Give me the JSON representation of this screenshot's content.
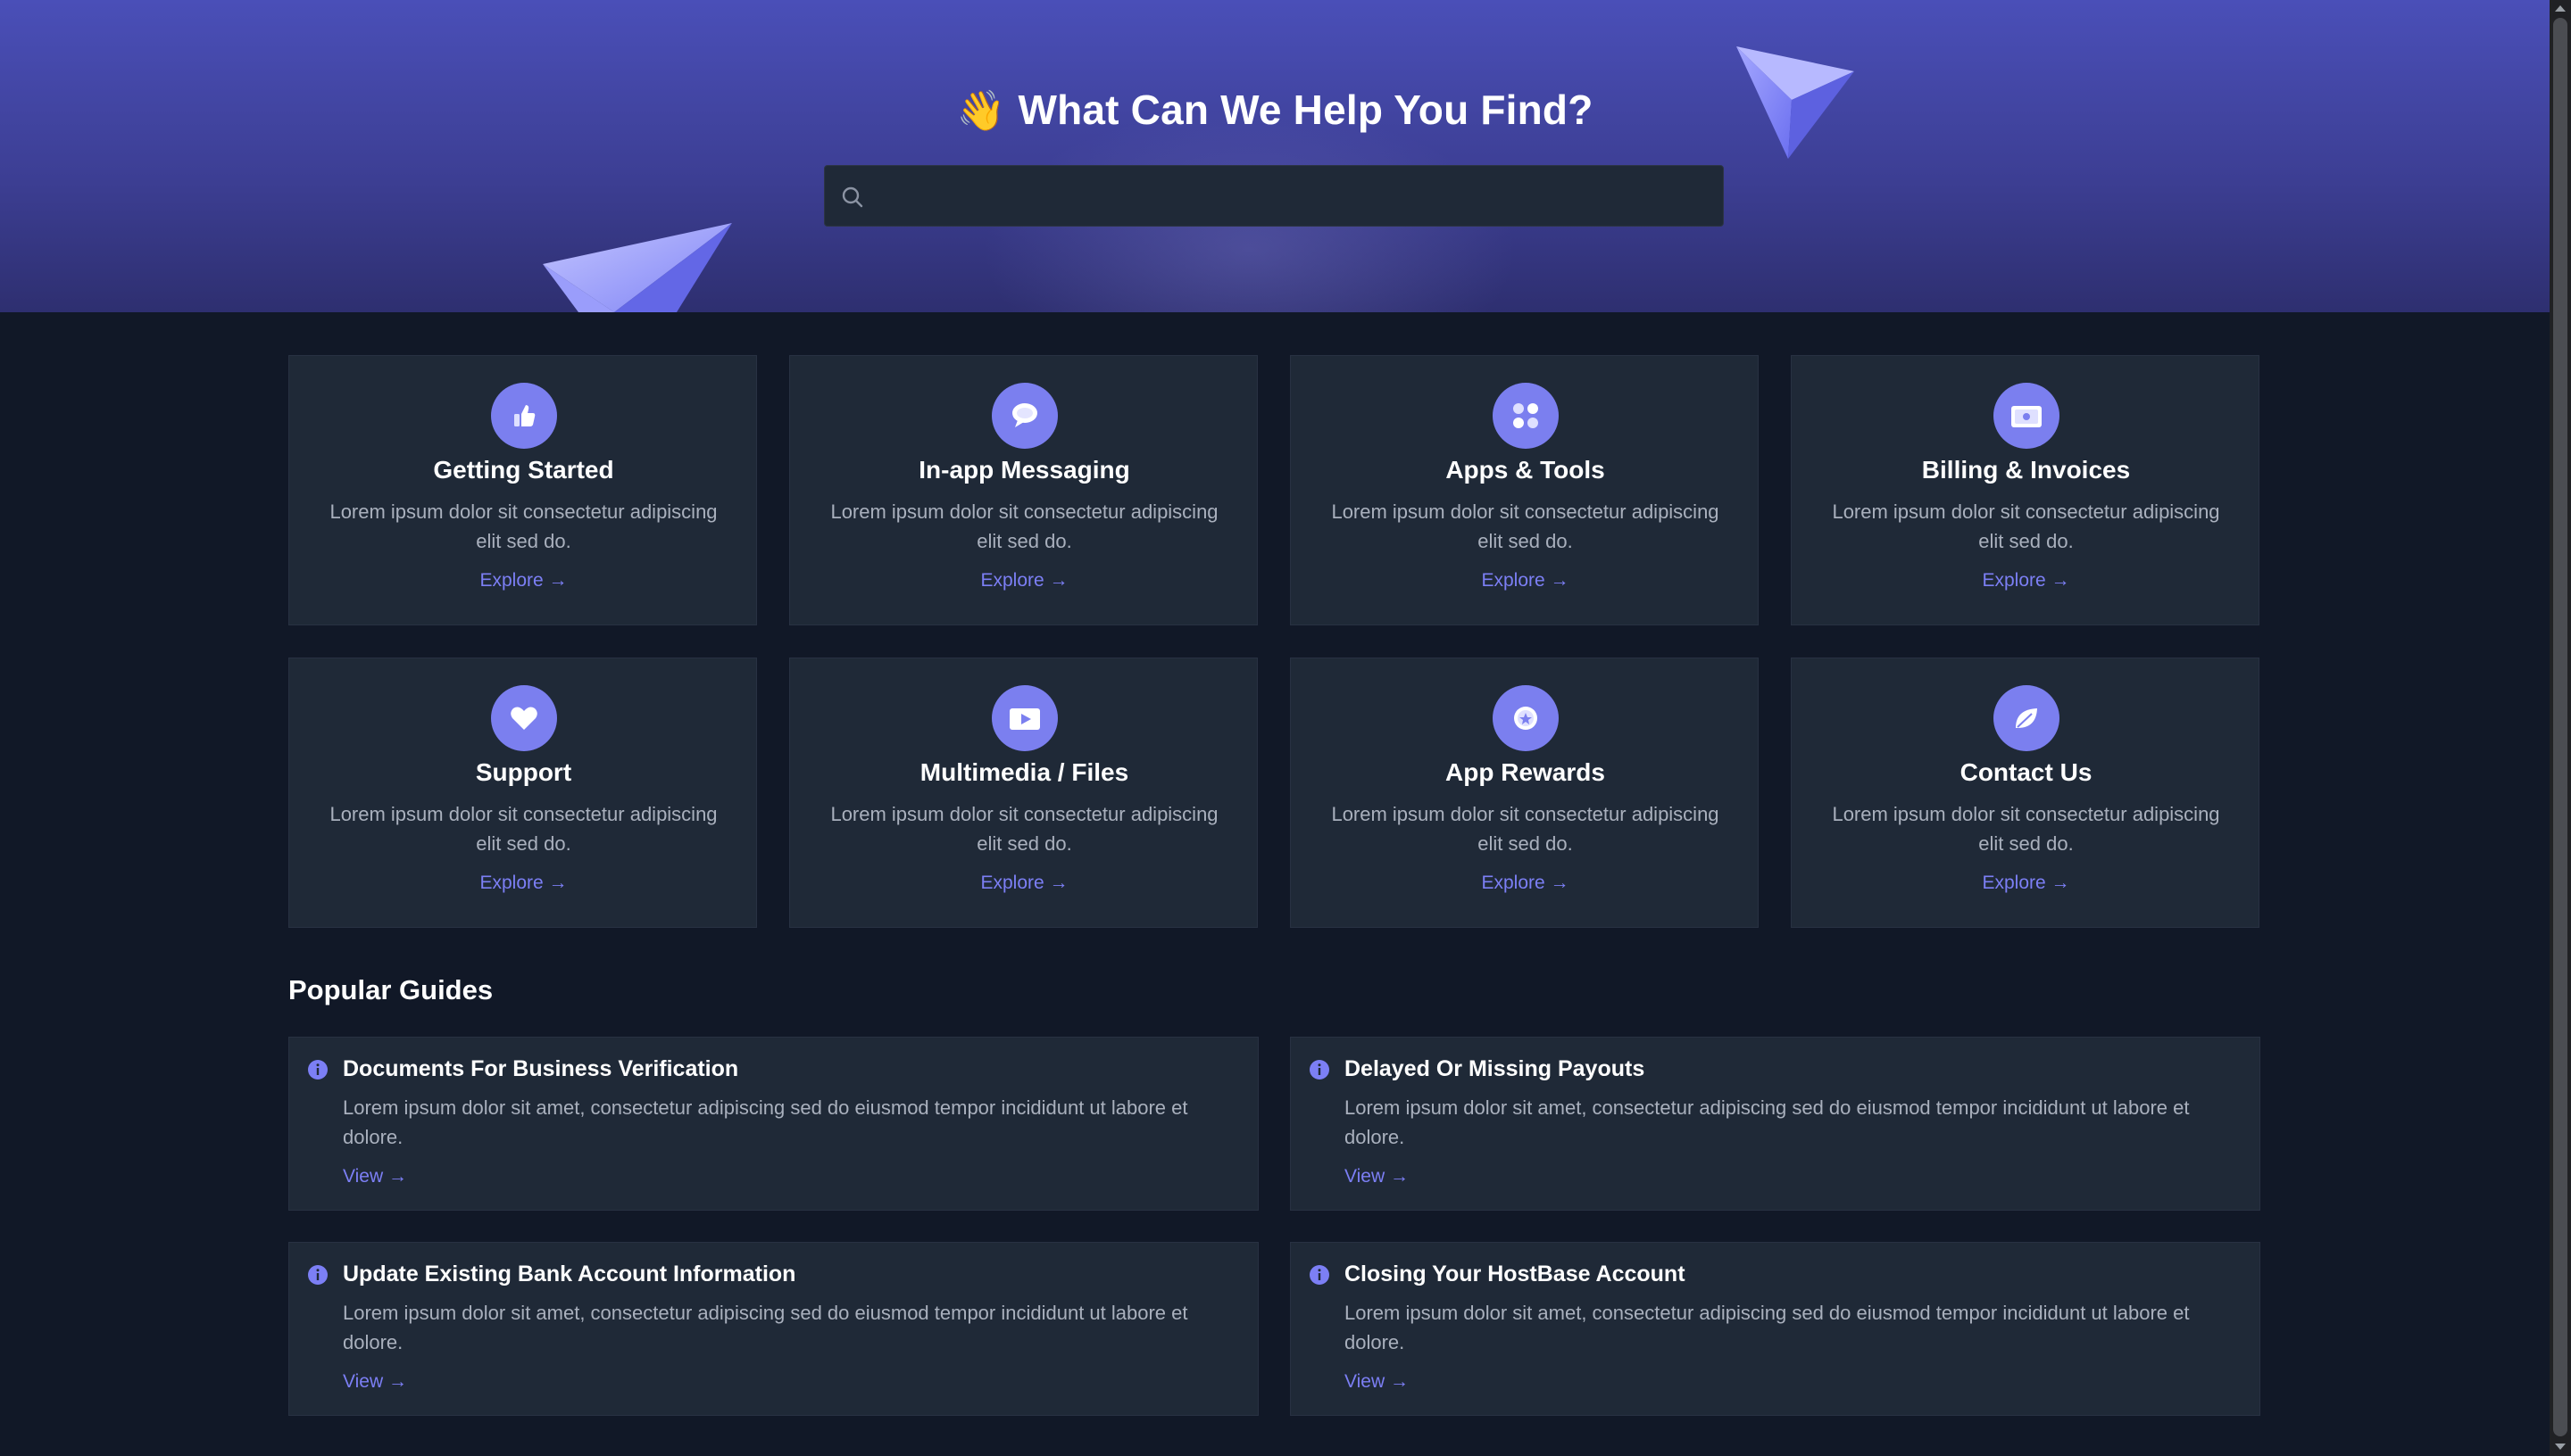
{
  "hero": {
    "emoji": "👋",
    "title": "What Can We Help You Find?",
    "search_value": ""
  },
  "colors": {
    "accent": "#7c7ff5",
    "hero_top": "#4a4fb8",
    "background": "#111827",
    "card": "#1f2937"
  },
  "categories": [
    {
      "title": "Getting Started",
      "desc": "Lorem ipsum dolor sit consectetur adipiscing elit sed do.",
      "link": "Explore →",
      "icon": "thumbs-up-icon"
    },
    {
      "title": "In-app Messaging",
      "desc": "Lorem ipsum dolor sit consectetur adipiscing elit sed do.",
      "link": "Explore →",
      "icon": "chat-bubble-icon"
    },
    {
      "title": "Apps & Tools",
      "desc": "Lorem ipsum dolor sit consectetur adipiscing elit sed do.",
      "link": "Explore →",
      "icon": "apps-grid-icon"
    },
    {
      "title": "Billing & Invoices",
      "desc": "Lorem ipsum dolor sit consectetur adipiscing elit sed do.",
      "link": "Explore →",
      "icon": "wallet-icon"
    },
    {
      "title": "Support",
      "desc": "Lorem ipsum dolor sit consectetur adipiscing elit sed do.",
      "link": "Explore →",
      "icon": "heart-icon"
    },
    {
      "title": "Multimedia / Files",
      "desc": "Lorem ipsum dolor sit consectetur adipiscing elit sed do.",
      "link": "Explore →",
      "icon": "video-icon"
    },
    {
      "title": "App Rewards",
      "desc": "Lorem ipsum dolor sit consectetur adipiscing elit sed do.",
      "link": "Explore →",
      "icon": "star-badge-icon"
    },
    {
      "title": "Contact Us",
      "desc": "Lorem ipsum dolor sit consectetur adipiscing elit sed do.",
      "link": "Explore →",
      "icon": "leaf-icon"
    }
  ],
  "guides_section": {
    "title": "Popular Guides",
    "items": [
      {
        "title": "Documents For Business Verification",
        "desc": "Lorem ipsum dolor sit amet, consectetur adipiscing sed do eiusmod tempor incididunt ut labore et dolore.",
        "link": "View →"
      },
      {
        "title": "Delayed Or Missing Payouts",
        "desc": "Lorem ipsum dolor sit amet, consectetur adipiscing sed do eiusmod tempor incididunt ut labore et dolore.",
        "link": "View →"
      },
      {
        "title": "Update Existing Bank Account Information",
        "desc": "Lorem ipsum dolor sit amet, consectetur adipiscing sed do eiusmod tempor incididunt ut labore et dolore.",
        "link": "View →"
      },
      {
        "title": "Closing Your HostBase Account",
        "desc": "Lorem ipsum dolor sit amet, consectetur adipiscing sed do eiusmod tempor incididunt ut labore et dolore.",
        "link": "View →"
      }
    ]
  }
}
